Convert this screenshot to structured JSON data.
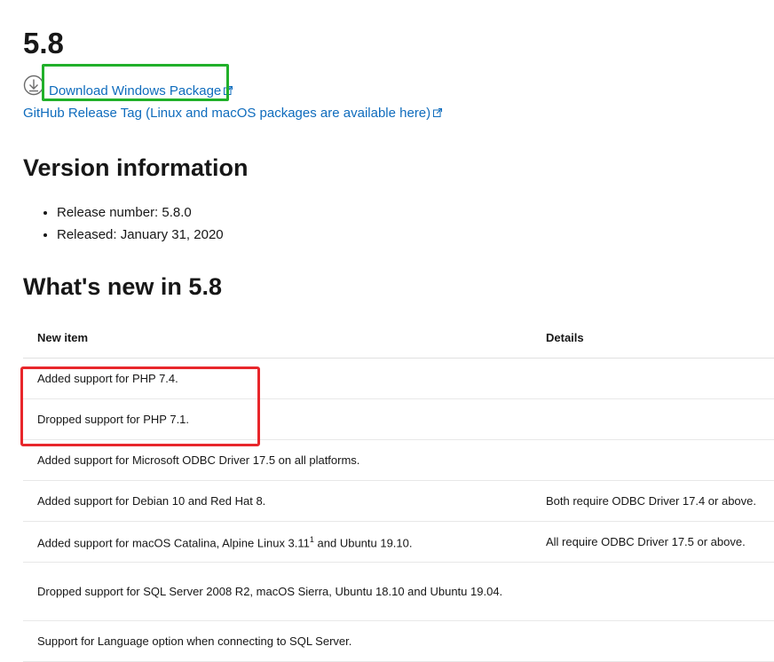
{
  "page": {
    "version_heading": "5.8",
    "download_link": "Download Windows Package",
    "github_link": "GitHub Release Tag (Linux and macOS packages are available here)",
    "version_info_heading": "Version information",
    "version_info": [
      "Release number: 5.8.0",
      "Released: January 31, 2020"
    ],
    "whats_new_heading": "What's new in 5.8"
  },
  "table": {
    "headers": [
      "New item",
      "Details"
    ],
    "rows": [
      {
        "item": "Added support for PHP 7.4.",
        "details": ""
      },
      {
        "item": "Dropped support for PHP 7.1.",
        "details": ""
      },
      {
        "item": "Added support for Microsoft ODBC Driver 17.5 on all platforms.",
        "details": ""
      },
      {
        "item": "Added support for Debian 10 and Red Hat 8.",
        "details": "Both require ODBC Driver 17.4 or above."
      },
      {
        "item_before": "Added support for macOS Catalina, Alpine Linux 3.11",
        "item_sup": "1",
        "item_after": " and Ubuntu 19.10.",
        "details": "All require ODBC Driver 17.5 or above."
      },
      {
        "item": "Dropped support for SQL Server 2008 R2, macOS Sierra, Ubuntu 18.10 and Ubuntu 19.04.",
        "details": ""
      },
      {
        "item": "Support for Language option when connecting to SQL Server.",
        "details": ""
      }
    ]
  },
  "icons": {
    "download": "download-circle-icon",
    "external": "external-link-icon"
  },
  "colors": {
    "link": "#0f6cbd",
    "highlight_green": "#21b02a",
    "highlight_red": "#e8262b"
  }
}
